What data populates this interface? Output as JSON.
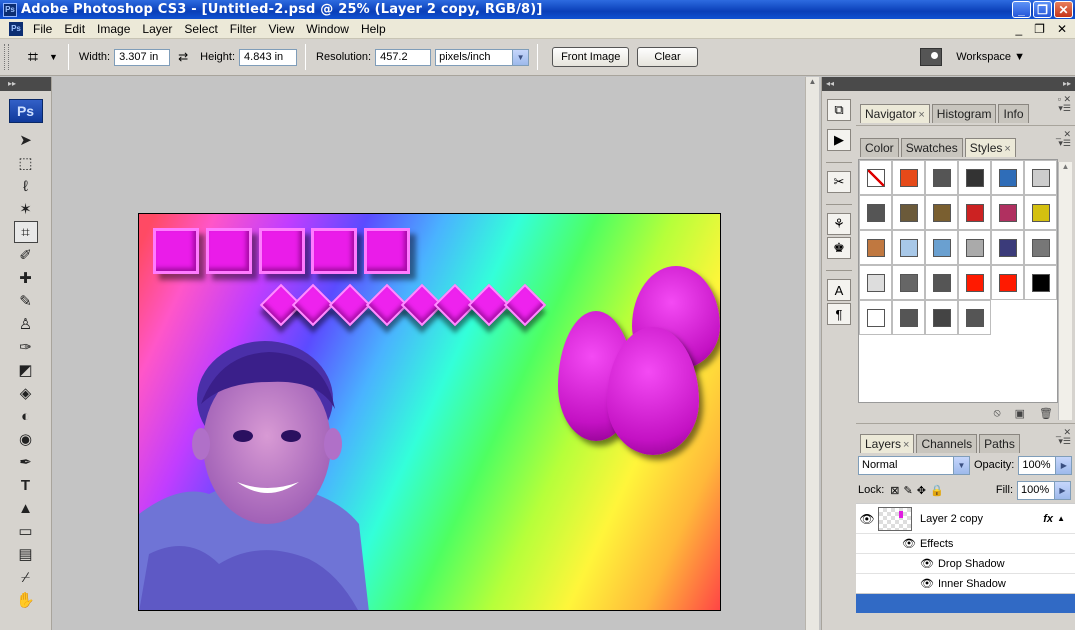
{
  "window": {
    "title": "Adobe Photoshop CS3 - [Untitled-2.psd @ 25% (Layer 2 copy, RGB/8)]",
    "app_icon": "Ps"
  },
  "menu": {
    "items": [
      "File",
      "Edit",
      "Image",
      "Layer",
      "Select",
      "Filter",
      "View",
      "Window",
      "Help"
    ],
    "app_icon": "Ps"
  },
  "options": {
    "width_label": "Width:",
    "width_value": "3.307 in",
    "height_label": "Height:",
    "height_value": "4.843 in",
    "resolution_label": "Resolution:",
    "resolution_value": "457.2",
    "unit_value": "pixels/inch",
    "front_image_label": "Front Image",
    "clear_label": "Clear",
    "workspace_label": "Workspace ▼"
  },
  "toolbox": {
    "logo": "Ps",
    "tools": [
      "move-tool",
      "marquee-tool",
      "lasso-tool",
      "magic-wand-tool",
      "crop-tool",
      "slice-tool",
      "healing-brush-tool",
      "brush-tool",
      "clone-stamp-tool",
      "history-brush-tool",
      "eraser-tool",
      "paint-bucket-tool",
      "blur-tool",
      "dodge-tool",
      "pen-tool",
      "type-tool",
      "path-selection-tool",
      "rectangle-tool",
      "notes-tool",
      "eyedropper-tool",
      "hand-tool"
    ],
    "active_tool": "crop-tool"
  },
  "panels": {
    "navigator_tabs": [
      "Navigator",
      "Histogram",
      "Info"
    ],
    "styles_tabs": [
      "Color",
      "Swatches",
      "Styles"
    ],
    "layers_tabs": [
      "Layers",
      "Channels",
      "Paths"
    ],
    "blend_mode": "Normal",
    "opacity_label": "Opacity:",
    "opacity_value": "100%",
    "lock_label": "Lock:",
    "fill_label": "Fill:",
    "fill_value": "100%",
    "layers": [
      {
        "name": "Layer 2 copy",
        "effects_label": "Effects",
        "effects": [
          "Drop Shadow",
          "Inner Shadow"
        ]
      }
    ],
    "style_swatches": [
      "#ffffff",
      "#e64a19",
      "#555555",
      "#333333",
      "#2f6db8",
      "#cccccc",
      "#555555",
      "#6b5a3a",
      "#7a5f30",
      "#cc2222",
      "#b03060",
      "#d4c010",
      "#c07840",
      "#a8c8e8",
      "#6aa0d0",
      "#aaaaaa",
      "#3b3b7a",
      "#777777",
      "#dddddd",
      "#666666",
      "#555555",
      "#ff1a00",
      "#ff1a00",
      "#000000",
      "#ffffff",
      "#555555",
      "#444444",
      "#555555"
    ]
  }
}
